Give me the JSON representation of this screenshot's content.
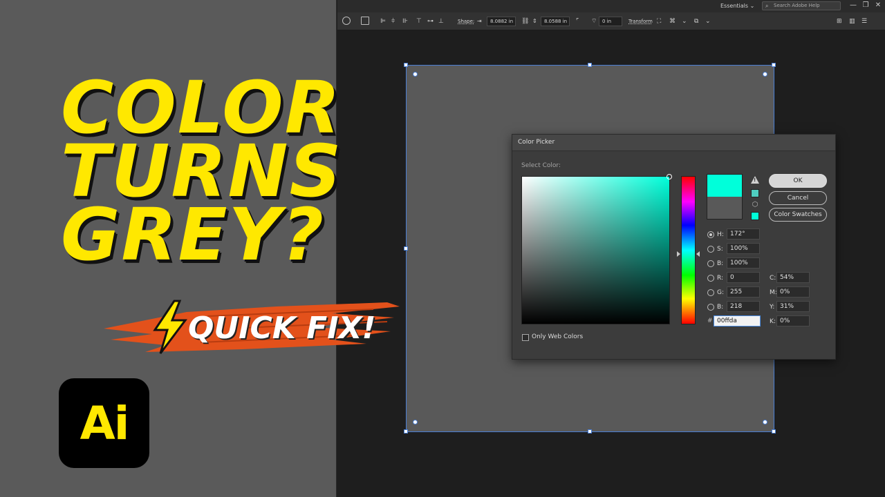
{
  "thumbnail": {
    "headline": [
      "COLOR",
      "TURNS",
      "GREY?"
    ],
    "tagline": "QUICK FIX!",
    "logo_text": "Ai",
    "colors": {
      "yellow": "#ffe800",
      "panel": "#5a5a5a",
      "brush": "#e3511b"
    }
  },
  "app": {
    "workspace": "Essentials",
    "search_placeholder": "Search Adobe Help",
    "window_controls": [
      "—",
      "❐",
      "✕"
    ]
  },
  "toolbar": {
    "shape_label": "Shape:",
    "width_value": "8.0882 in",
    "height_value": "8.0588 in",
    "corner_value": "0 in",
    "transform_label": "Transform"
  },
  "color_picker": {
    "title": "Color Picker",
    "select_label": "Select Color:",
    "buttons": {
      "ok": "OK",
      "cancel": "Cancel",
      "swatches": "Color Swatches"
    },
    "new_color": "#00ffda",
    "old_color": "#595959",
    "hsb": [
      {
        "label": "H:",
        "value": "172°",
        "selected": true
      },
      {
        "label": "S:",
        "value": "100%",
        "selected": false
      },
      {
        "label": "B:",
        "value": "100%",
        "selected": false
      }
    ],
    "rgb": [
      {
        "label": "R:",
        "value": "0"
      },
      {
        "label": "G:",
        "value": "255"
      },
      {
        "label": "B:",
        "value": "218"
      }
    ],
    "cmyk": [
      {
        "label": "C:",
        "value": "54%"
      },
      {
        "label": "M:",
        "value": "0%"
      },
      {
        "label": "Y:",
        "value": "31%"
      },
      {
        "label": "K:",
        "value": "0%"
      }
    ],
    "hex_label": "#",
    "hex_value": "00ffda",
    "only_web_label": "Only Web Colors"
  }
}
